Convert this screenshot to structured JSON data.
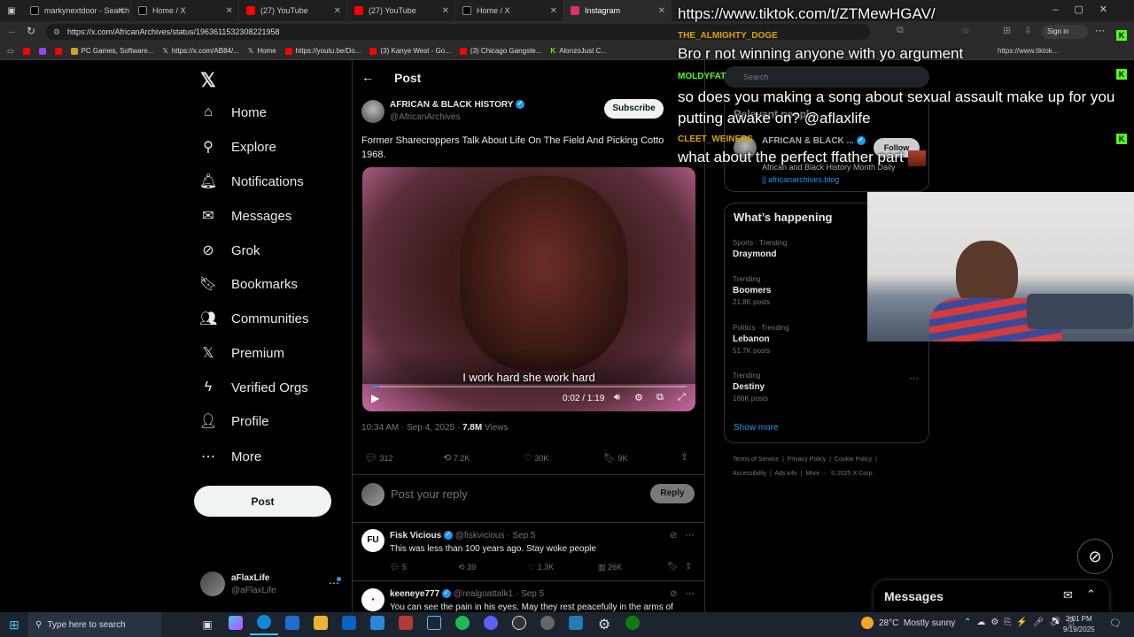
{
  "browser": {
    "tabs": [
      {
        "title": "markynextdoor - Search",
        "color": "#000000"
      },
      {
        "title": "Home / X",
        "color": "#000000"
      },
      {
        "title": "(27) YouTube",
        "color": "#ff0000"
      },
      {
        "title": "(27) YouTube",
        "color": "#ff0000"
      },
      {
        "title": "Home / X",
        "color": "#000000"
      },
      {
        "title": "Instagram",
        "color": "#e1306c"
      }
    ],
    "url": "https://x.com/AfricanArchives/status/1963611532308221958",
    "bookmarks": [
      "PC Games, Software...",
      "https://x.com/AB84/...",
      "Home",
      "https://youtu.be/Do...",
      "(3) Kanye West - Go...",
      "(3) Chicago Gangste...",
      "AlonzoJust C..."
    ],
    "sign_in": "Sign in",
    "tiktok_short": "https://www.tiktok..."
  },
  "nav": {
    "items": [
      {
        "label": "Home",
        "icon": "home-icon"
      },
      {
        "label": "Explore",
        "icon": "search-icon"
      },
      {
        "label": "Notifications",
        "icon": "bell-icon"
      },
      {
        "label": "Messages",
        "icon": "envelope-icon"
      },
      {
        "label": "Grok",
        "icon": "grok-icon"
      },
      {
        "label": "Bookmarks",
        "icon": "bookmark-icon"
      },
      {
        "label": "Communities",
        "icon": "people-icon"
      },
      {
        "label": "Premium",
        "icon": "x-logo-icon"
      },
      {
        "label": "Verified Orgs",
        "icon": "lightning-icon"
      },
      {
        "label": "Profile",
        "icon": "person-icon"
      },
      {
        "label": "More",
        "icon": "more-circle-icon"
      }
    ],
    "post_label": "Post",
    "account_name": "aFlaxLife",
    "account_handle": "@aFlaxLife"
  },
  "post": {
    "header_title": "Post",
    "author_name": "AFRICAN & BLACK HISTORY",
    "author_handle": "@AfricanArchives",
    "subscribe_label": "Subscribe",
    "text": "Former Sharecroppers Talk About Life On The Field And Picking Cotto... 1968.",
    "text_line1": "Former Sharecroppers Talk About Life On The Field And Picking Cotto",
    "text_line2": "1968.",
    "video_caption": "I work hard she work hard",
    "video_time": "0:02 / 1:19",
    "video_progress": 0.025,
    "timestamp": "10:34 AM · Sep 4, 2025 · ",
    "views": "7.8M",
    "views_label": " Views",
    "stats": {
      "replies": "312",
      "reposts": "7.2K",
      "likes": "30K",
      "bookmarks": "9K"
    },
    "reply_placeholder": "Post your reply",
    "reply_button": "Reply"
  },
  "replies": [
    {
      "name": "Fisk Vicious",
      "handle": "@fiskvicious",
      "date": "· Sep 5",
      "text": "This was less than 100 years ago. Stay woke people",
      "replies": "5",
      "reposts": "39",
      "likes": "1.3K",
      "views": "26K"
    },
    {
      "name": "keeneye777",
      "handle": "@realgoattalk1",
      "date": "· Sep 5",
      "text": "You can see the pain in his eyes. May they rest peacefully in the arms of"
    }
  ],
  "right": {
    "relevant_title": "Relevant people",
    "relevant_name": "AFRICAN & BLACK ...",
    "relevant_follow": "Follow",
    "relevant_bio": "African and Black History Month Daily",
    "relevant_link": "|| africanarchives.blog",
    "search_placeholder": "Search",
    "happening_title": "What’s happening",
    "trends": [
      {
        "context": "Sports · Trending",
        "name": "Draymond",
        "posts": ""
      },
      {
        "context": "Trending",
        "name": "Boomers",
        "posts": "21.8K posts"
      },
      {
        "context": "Politics · Trending",
        "name": "Lebanon",
        "posts": "51.7K posts"
      },
      {
        "context": "Trending",
        "name": "Destiny",
        "posts": "166K posts"
      }
    ],
    "show_more": "Show more",
    "footer1": "Terms of Service  |  Privacy Policy  |  Cookie Policy  |",
    "footer2": "Accessibility  |  Ads info  |  More ···  © 2025 X Corp.",
    "messages_label": "Messages"
  },
  "chat": {
    "url_line": "https://www.tiktok.com/t/ZTMewHGAV/",
    "messages": [
      {
        "user": "THE_ALMIGHTY_DOGE",
        "color": "#d9a400",
        "text": "Bro r not winning anyone with yo argument"
      },
      {
        "user": "MOLDYFAT",
        "color": "#53fc18",
        "text": "so does you making a song about sexual assault make up for you putting awake on? @aflaxlife"
      },
      {
        "user": "CLEET_WEINERS",
        "color": "#d9a400",
        "text": "what about the perfect ffather part"
      }
    ]
  },
  "taskbar": {
    "search_placeholder": "Type here to search",
    "weather": "28°C  Mostly sunny",
    "time": "2:01 PM",
    "date": "9/19/2025"
  }
}
